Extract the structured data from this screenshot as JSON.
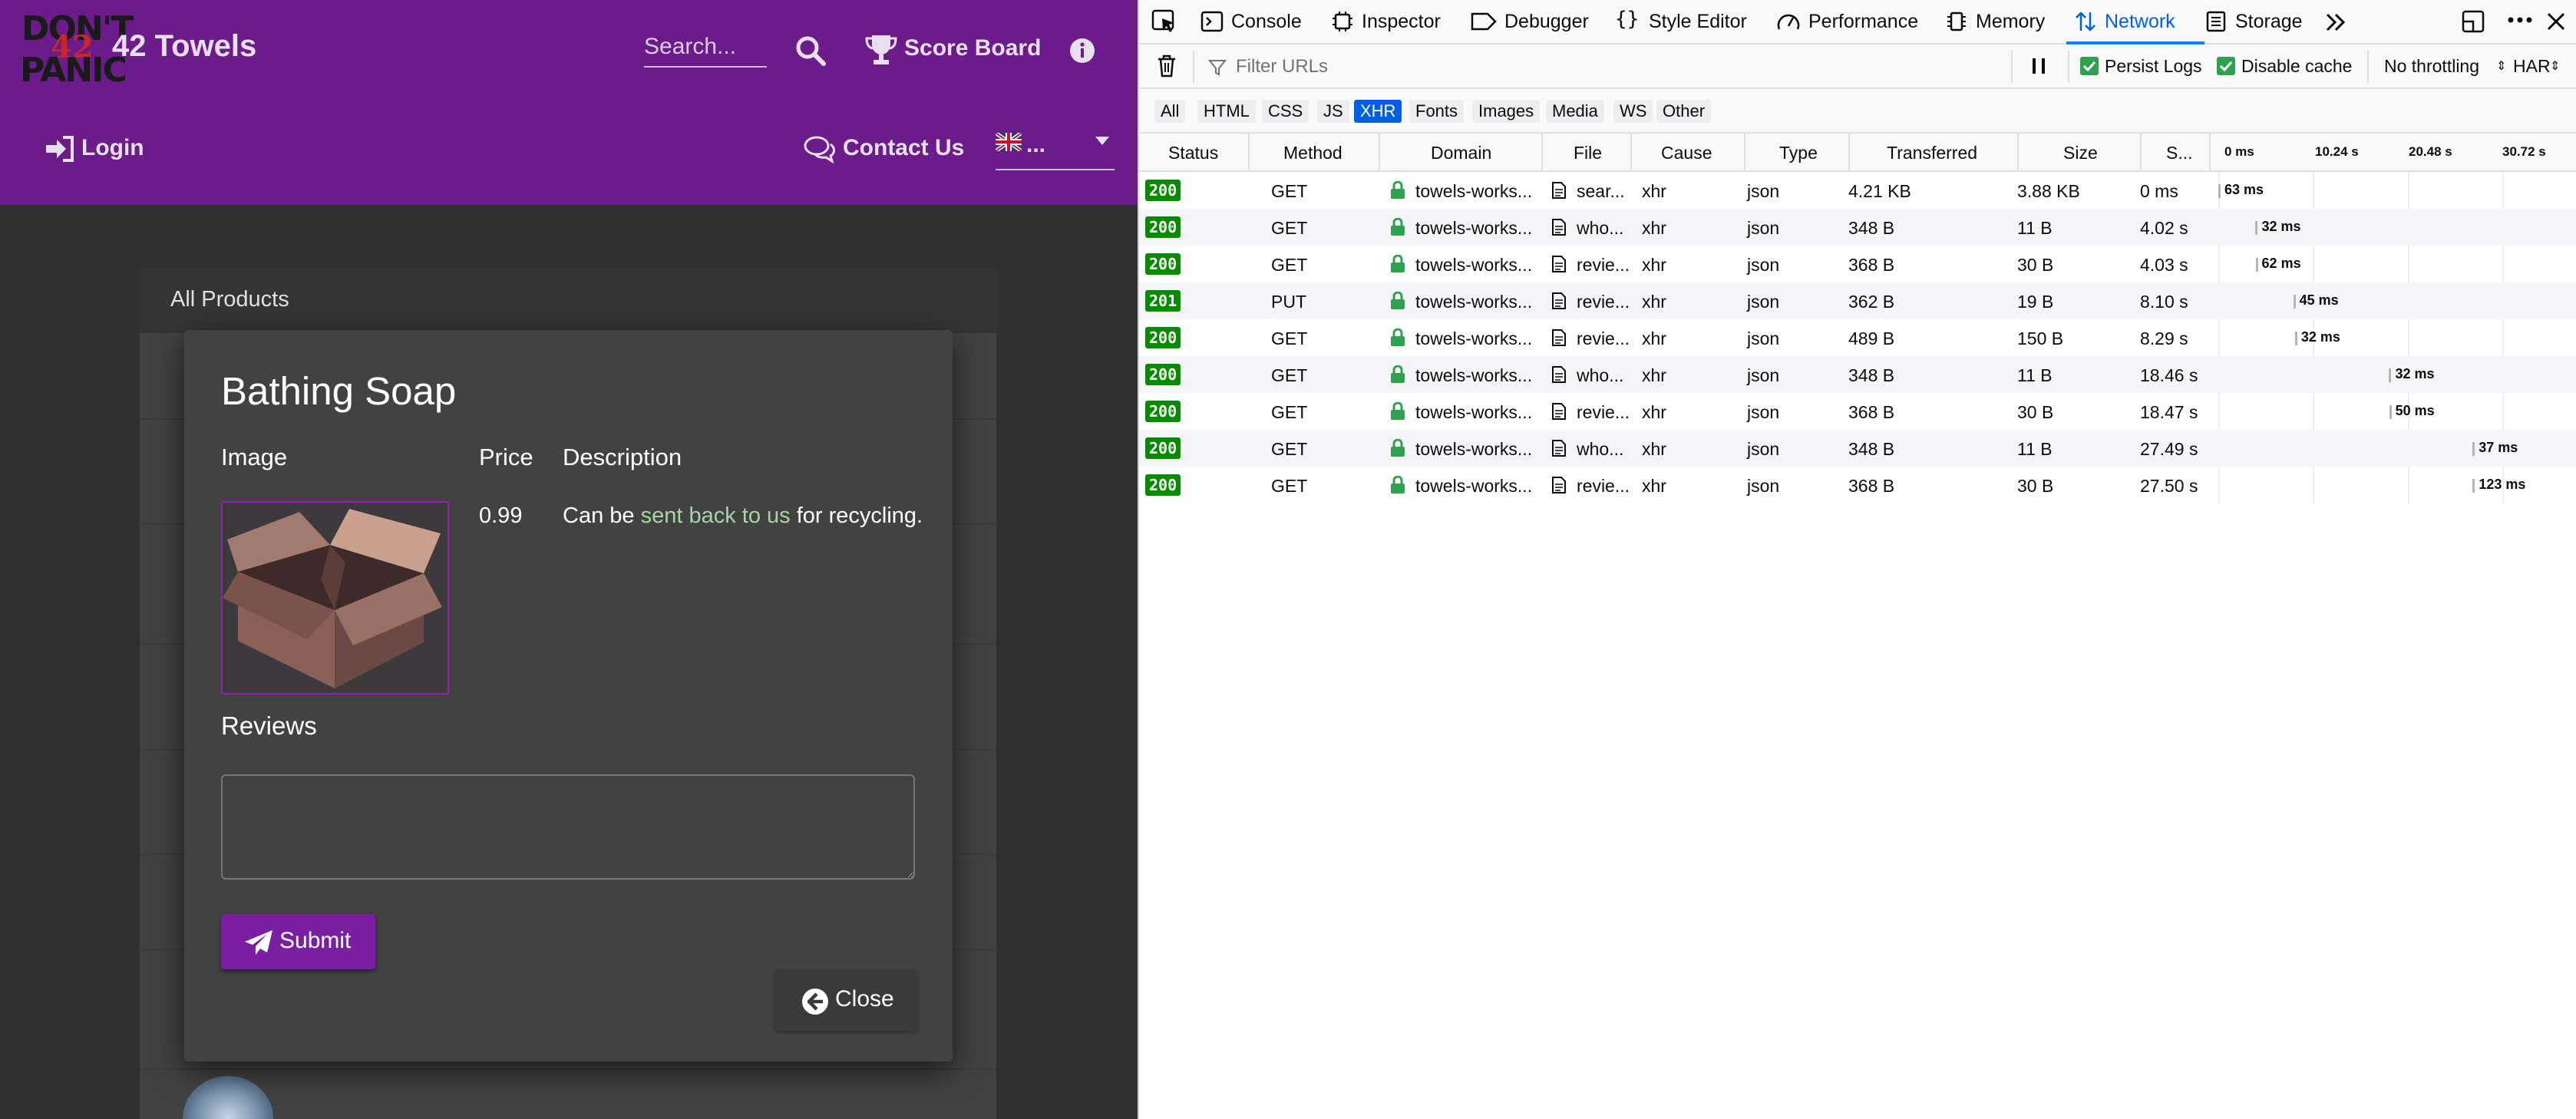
{
  "app": {
    "logo": {
      "line1": "DON'T",
      "line2": "PANIC",
      "number": "42"
    },
    "title": "42 Towels",
    "search_placeholder": "Search...",
    "score_board_label": "Score Board",
    "login_label": "Login",
    "contact_label": "Contact Us",
    "language_value": "...",
    "background": {
      "all_products_label": "All Products"
    }
  },
  "dialog": {
    "title": "Bathing Soap",
    "headers": {
      "image": "Image",
      "price": "Price",
      "description": "Description"
    },
    "price": "0.99",
    "description": {
      "before": "Can be ",
      "link": "sent back to us",
      "after": " for recycling."
    },
    "reviews_heading": "Reviews",
    "review_input_value": "",
    "submit_label": "Submit",
    "close_label": "Close"
  },
  "devtools": {
    "tabs": [
      {
        "label": "Console",
        "icon": "console-icon"
      },
      {
        "label": "Inspector",
        "icon": "inspector-icon"
      },
      {
        "label": "Debugger",
        "icon": "debugger-icon"
      },
      {
        "label": "Style Editor",
        "icon": "braces-icon"
      },
      {
        "label": "Performance",
        "icon": "gauge-icon"
      },
      {
        "label": "Memory",
        "icon": "chip-icon"
      },
      {
        "label": "Network",
        "icon": "arrows-icon",
        "selected": true
      },
      {
        "label": "Storage",
        "icon": "storage-icon"
      }
    ],
    "filter_placeholder": "Filter URLs",
    "persist_logs_label": "Persist Logs",
    "disable_cache_label": "Disable cache",
    "throttling_value": "No throttling",
    "har_label": "HAR",
    "type_filters": [
      "All",
      "HTML",
      "CSS",
      "JS",
      "XHR",
      "Fonts",
      "Images",
      "Media",
      "WS",
      "Other"
    ],
    "selected_type": "XHR",
    "columns": [
      "Status",
      "Method",
      "Domain",
      "File",
      "Cause",
      "Type",
      "Transferred",
      "Size",
      "S..."
    ],
    "waterfall_ticks": [
      "0 ms",
      "10.24 s",
      "20.48 s",
      "30.72 s"
    ],
    "requests": [
      {
        "status": "200",
        "method": "GET",
        "domain": "towels-works...",
        "file": "sear...",
        "cause": "xhr",
        "type": "json",
        "transferred": "4.21 KB",
        "size": "3.88 KB",
        "start": "0 ms",
        "duration": "63 ms",
        "start_s": 0.0
      },
      {
        "status": "200",
        "method": "GET",
        "domain": "towels-works...",
        "file": "who...",
        "cause": "xhr",
        "type": "json",
        "transferred": "348 B",
        "size": "11 B",
        "start": "4.02 s",
        "duration": "32 ms",
        "start_s": 4.02
      },
      {
        "status": "200",
        "method": "GET",
        "domain": "towels-works...",
        "file": "revie...",
        "cause": "xhr",
        "type": "json",
        "transferred": "368 B",
        "size": "30 B",
        "start": "4.03 s",
        "duration": "62 ms",
        "start_s": 4.03
      },
      {
        "status": "201",
        "method": "PUT",
        "domain": "towels-works...",
        "file": "revie...",
        "cause": "xhr",
        "type": "json",
        "transferred": "362 B",
        "size": "19 B",
        "start": "8.10 s",
        "duration": "45 ms",
        "start_s": 8.1
      },
      {
        "status": "200",
        "method": "GET",
        "domain": "towels-works...",
        "file": "revie...",
        "cause": "xhr",
        "type": "json",
        "transferred": "489 B",
        "size": "150 B",
        "start": "8.29 s",
        "duration": "32 ms",
        "start_s": 8.29
      },
      {
        "status": "200",
        "method": "GET",
        "domain": "towels-works...",
        "file": "who...",
        "cause": "xhr",
        "type": "json",
        "transferred": "348 B",
        "size": "11 B",
        "start": "18.46 s",
        "duration": "32 ms",
        "start_s": 18.46
      },
      {
        "status": "200",
        "method": "GET",
        "domain": "towels-works...",
        "file": "revie...",
        "cause": "xhr",
        "type": "json",
        "transferred": "368 B",
        "size": "30 B",
        "start": "18.47 s",
        "duration": "50 ms",
        "start_s": 18.47
      },
      {
        "status": "200",
        "method": "GET",
        "domain": "towels-works...",
        "file": "who...",
        "cause": "xhr",
        "type": "json",
        "transferred": "348 B",
        "size": "11 B",
        "start": "27.49 s",
        "duration": "37 ms",
        "start_s": 27.49
      },
      {
        "status": "200",
        "method": "GET",
        "domain": "towels-works...",
        "file": "revie...",
        "cause": "xhr",
        "type": "json",
        "transferred": "368 B",
        "size": "30 B",
        "start": "27.50 s",
        "duration": "123 ms",
        "start_s": 27.5
      }
    ],
    "colors": {
      "status_ok": "#058b00",
      "accent": "#0a84ff",
      "selected_filter": "#0060df"
    }
  }
}
